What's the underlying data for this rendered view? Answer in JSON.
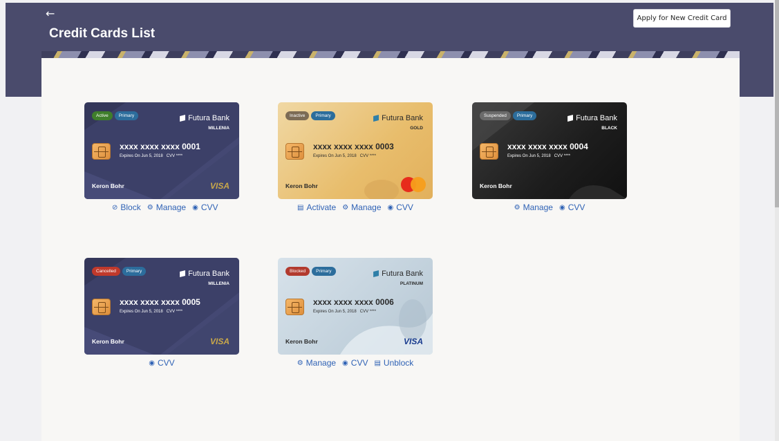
{
  "header": {
    "title": "Credit Cards List",
    "back_icon": "←",
    "apply_button": "Apply for New Credit Card"
  },
  "colors": {
    "header_bg": "#4a4b6c",
    "link": "#2f62b5",
    "status_active": "#3f7e2b",
    "status_inactive": "#7c6b55",
    "status_suspended": "#6b6b6b",
    "status_cancelled": "#c0392b",
    "status_blocked": "#b23a2e",
    "primary_badge": "#2c6d9c"
  },
  "cards": [
    {
      "status": "Active",
      "type_badge": "Primary",
      "bank": "Futura Bank",
      "tier": "MILLENIA",
      "number_prefix": "xxxx xxxx xxxx",
      "number_suffix": "0001",
      "expiry": "Expires On Jun 5, 2018",
      "cvv": "CVV ****",
      "holder": "Keron Bohr",
      "network": "VISA",
      "actions": [
        {
          "icon": "⊘",
          "label": "Block"
        },
        {
          "icon": "⚙",
          "label": "Manage"
        },
        {
          "icon": "◉",
          "label": "CVV"
        }
      ]
    },
    {
      "status": "Inactive",
      "type_badge": "Primary",
      "bank": "Futura Bank",
      "tier": "GOLD",
      "number_prefix": "xxxx xxxx xxxx",
      "number_suffix": "0003",
      "expiry": "Expires On Jun 5, 2018",
      "cvv": "CVV ****",
      "holder": "Keron Bohr",
      "network": "mastercard",
      "actions": [
        {
          "icon": "▤",
          "label": "Activate"
        },
        {
          "icon": "⚙",
          "label": "Manage"
        },
        {
          "icon": "◉",
          "label": "CVV"
        }
      ]
    },
    {
      "status": "Suspended",
      "type_badge": "Primary",
      "bank": "Futura Bank",
      "tier": "BLACK",
      "number_prefix": "xxxx xxxx xxxx",
      "number_suffix": "0004",
      "expiry": "Expires On Jun 5, 2018",
      "cvv": "CVV ****",
      "holder": "Keron Bohr",
      "network": "",
      "actions": [
        {
          "icon": "⚙",
          "label": "Manage"
        },
        {
          "icon": "◉",
          "label": "CVV"
        }
      ]
    },
    {
      "status": "Cancelled",
      "type_badge": "Primary",
      "bank": "Futura Bank",
      "tier": "MILLENIA",
      "number_prefix": "xxxx xxxx xxxx",
      "number_suffix": "0005",
      "expiry": "Expires On Jun 5, 2018",
      "cvv": "CVV ****",
      "holder": "Keron Bohr",
      "network": "VISA",
      "actions": [
        {
          "icon": "◉",
          "label": "CVV"
        }
      ]
    },
    {
      "status": "Blocked",
      "type_badge": "Primary",
      "bank": "Futura Bank",
      "tier": "PLATINUM",
      "number_prefix": "xxxx xxxx xxxx",
      "number_suffix": "0006",
      "expiry": "Expires On Jun 5, 2018",
      "cvv": "CVV ****",
      "holder": "Keron Bohr",
      "network": "VISA",
      "actions": [
        {
          "icon": "⚙",
          "label": "Manage"
        },
        {
          "icon": "◉",
          "label": "CVV"
        },
        {
          "icon": "▤",
          "label": "Unblock"
        }
      ]
    }
  ]
}
